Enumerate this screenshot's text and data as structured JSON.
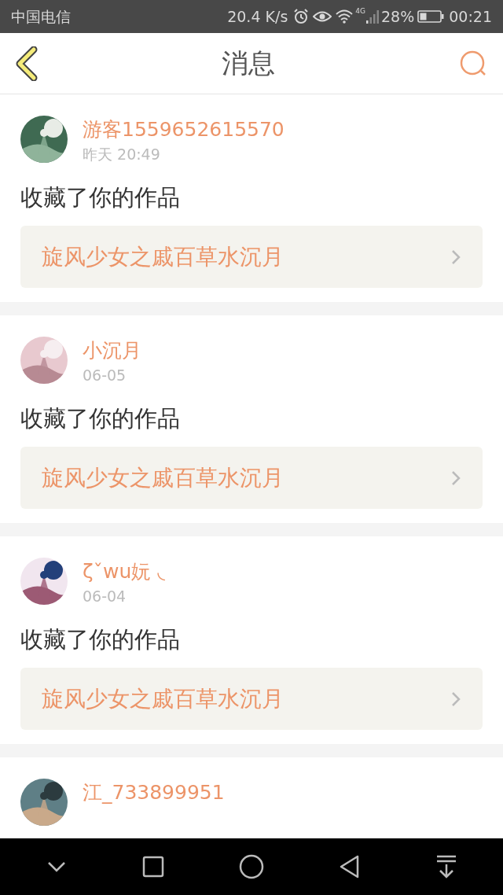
{
  "status_bar": {
    "carrier": "中国电信",
    "speed": "20.4 K/s",
    "network": "4G",
    "battery": "28%",
    "time": "00:21"
  },
  "header": {
    "title": "消息"
  },
  "messages": [
    {
      "user": "游客1559652615570",
      "time": "昨天 20:49",
      "action": "收藏了你的作品",
      "work": "旋风少女之戚百草水沉月"
    },
    {
      "user": "小沉月",
      "time": "06-05",
      "action": "收藏了你的作品",
      "work": "旋风少女之戚百草水沉月"
    },
    {
      "user": "ζˇwu妧 ◟",
      "time": "06-04",
      "action": "收藏了你的作品",
      "work": "旋风少女之戚百草水沉月"
    },
    {
      "user": "江_733899951"
    }
  ]
}
